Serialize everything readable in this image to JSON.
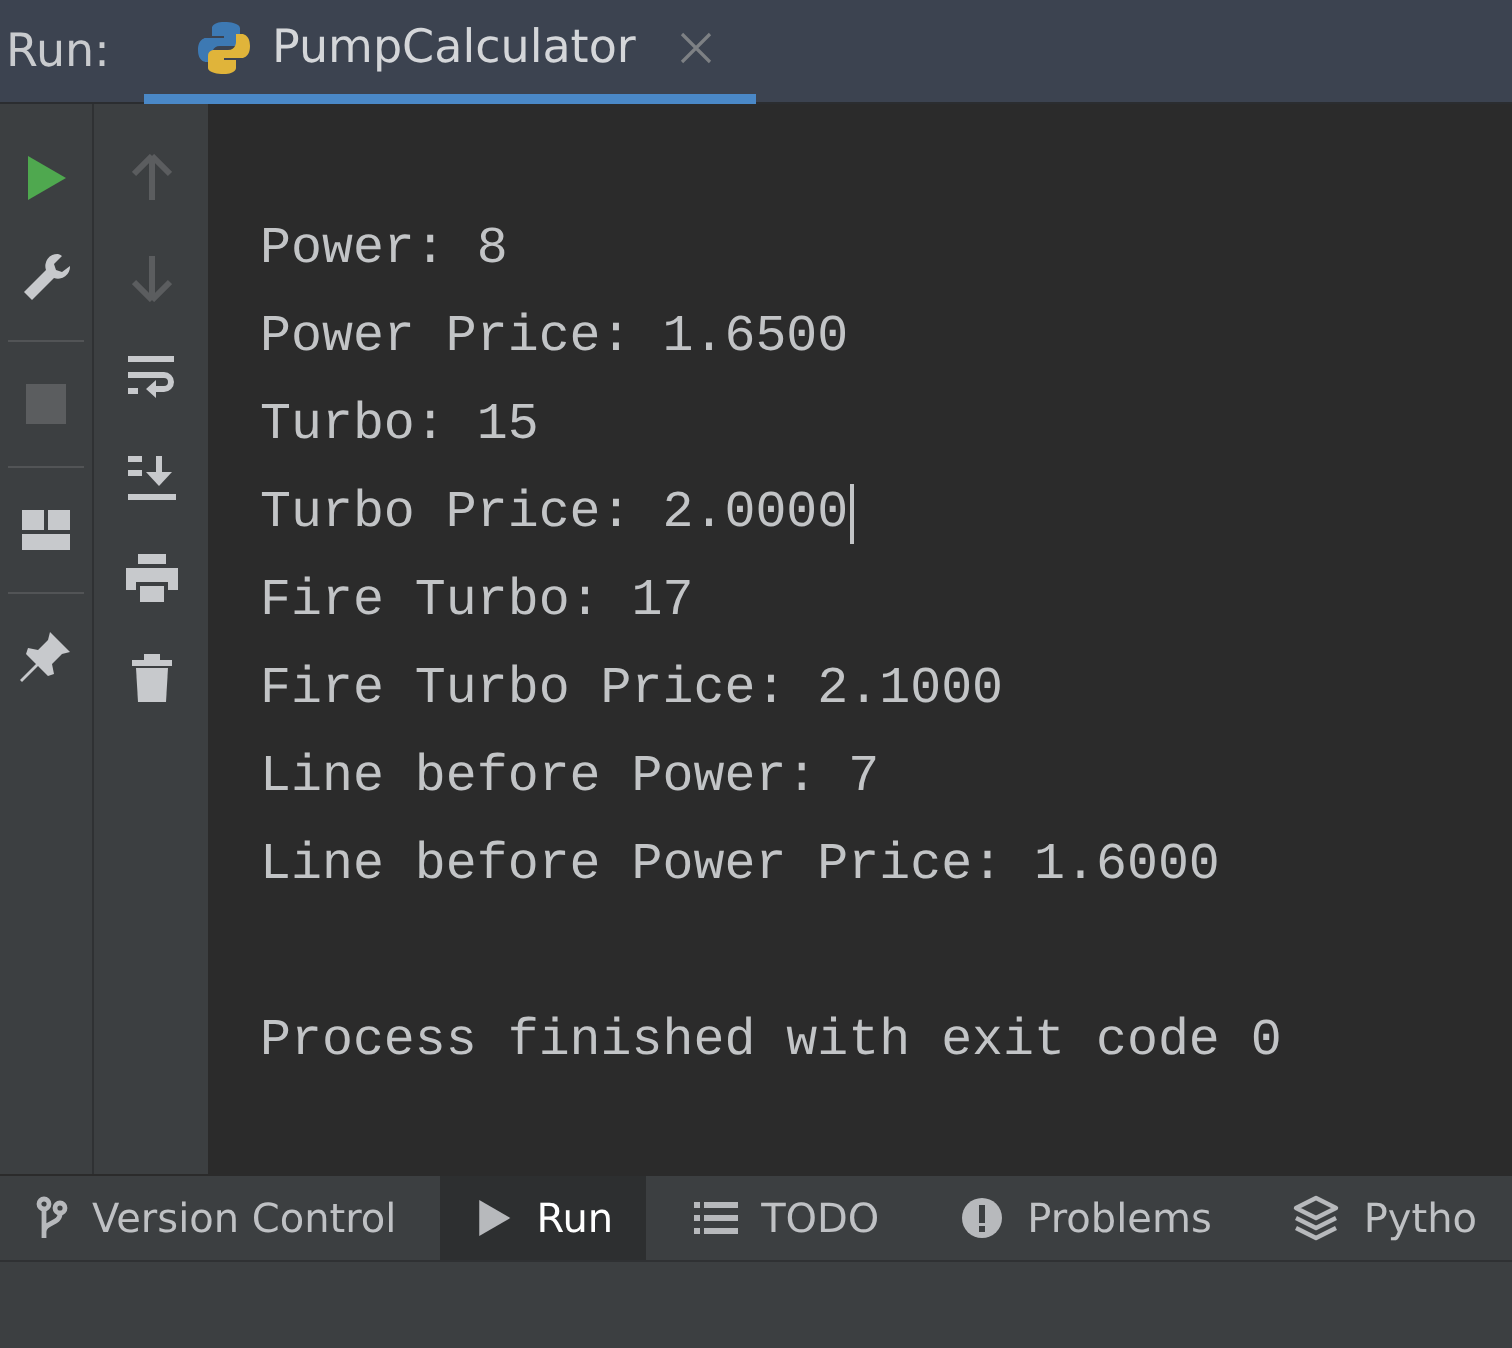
{
  "header": {
    "label": "Run:",
    "tabs": [
      {
        "title": "PumpCalculator",
        "selected": true,
        "closable": true
      }
    ]
  },
  "toolbar_left": [
    {
      "kind": "run",
      "disabled": false
    },
    {
      "kind": "wrench",
      "disabled": false
    },
    {
      "kind": "stop",
      "disabled": true
    },
    {
      "kind": "layout",
      "disabled": false
    },
    {
      "kind": "pin",
      "disabled": false
    }
  ],
  "toolbar_right": [
    {
      "kind": "up",
      "disabled": true
    },
    {
      "kind": "down",
      "disabled": true
    },
    {
      "kind": "wrap",
      "disabled": false
    },
    {
      "kind": "scroll-end",
      "disabled": false
    },
    {
      "kind": "print",
      "disabled": false
    },
    {
      "kind": "trash",
      "disabled": false
    }
  ],
  "console": {
    "lines": [
      {
        "kind": "output",
        "text": "Power: 8",
        "cursor": false
      },
      {
        "kind": "output",
        "text": "Power Price: 1.6500",
        "cursor": false
      },
      {
        "kind": "output",
        "text": "Turbo: 15",
        "cursor": false
      },
      {
        "kind": "output",
        "text": "Turbo Price: 2.0000",
        "cursor": true
      },
      {
        "kind": "output",
        "text": "Fire Turbo: 17",
        "cursor": false
      },
      {
        "kind": "output",
        "text": "Fire Turbo Price: 2.1000",
        "cursor": false
      },
      {
        "kind": "output",
        "text": "Line before Power: 7",
        "cursor": false
      },
      {
        "kind": "output",
        "text": "Line before Power Price: 1.6000",
        "cursor": false
      },
      {
        "kind": "blank"
      },
      {
        "kind": "output",
        "text": "Process finished with exit code 0",
        "cursor": false
      }
    ]
  },
  "tool_windows": [
    {
      "kind": "vcs",
      "label": "Version Control",
      "selected": false
    },
    {
      "kind": "run",
      "label": "Run",
      "selected": true
    },
    {
      "kind": "todo",
      "label": "TODO",
      "selected": false
    },
    {
      "kind": "problems",
      "label": "Problems",
      "selected": false
    },
    {
      "kind": "python",
      "label": "Pytho",
      "selected": false
    }
  ]
}
